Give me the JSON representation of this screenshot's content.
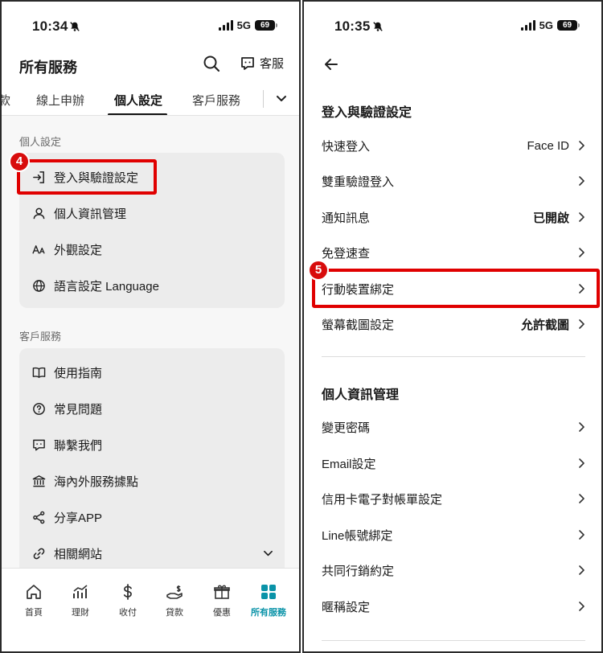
{
  "left": {
    "status": {
      "time": "10:34",
      "network": "5G",
      "battery": "69"
    },
    "header": {
      "title": "所有服務",
      "customer_service": "客服"
    },
    "tabs": [
      {
        "label": "款"
      },
      {
        "label": "線上申辦"
      },
      {
        "label": "個人設定",
        "active": true
      },
      {
        "label": "客戶服務"
      }
    ],
    "sections": [
      {
        "title": "個人設定",
        "items": [
          {
            "label": "登入與驗證設定",
            "icon": "login-icon"
          },
          {
            "label": "個人資訊管理",
            "icon": "person-icon"
          },
          {
            "label": "外觀設定",
            "icon": "font-size-icon"
          },
          {
            "label": "語言設定 Language",
            "icon": "globe-icon"
          }
        ]
      },
      {
        "title": "客戶服務",
        "items": [
          {
            "label": "使用指南",
            "icon": "book-icon"
          },
          {
            "label": "常見問題",
            "icon": "question-icon"
          },
          {
            "label": "聯繫我們",
            "icon": "contact-icon"
          },
          {
            "label": "海內外服務據點",
            "icon": "bank-icon"
          },
          {
            "label": "分享APP",
            "icon": "share-icon"
          },
          {
            "label": "相關網站",
            "icon": "link-icon"
          }
        ]
      }
    ],
    "step_badge": "4",
    "bottom_nav": [
      {
        "label": "首頁",
        "icon": "home-icon"
      },
      {
        "label": "理財",
        "icon": "chart-icon"
      },
      {
        "label": "收付",
        "icon": "dollar-icon"
      },
      {
        "label": "貸款",
        "icon": "loan-icon"
      },
      {
        "label": "優惠",
        "icon": "gift-icon"
      },
      {
        "label": "所有服務",
        "icon": "grid-icon",
        "active": true
      }
    ],
    "accent_color": "#0a93a8"
  },
  "right": {
    "status": {
      "time": "10:35",
      "network": "5G",
      "battery": "69"
    },
    "sections": [
      {
        "title": "登入與驗證設定",
        "items": [
          {
            "label": "快速登入",
            "value": "Face ID"
          },
          {
            "label": "雙重驗證登入",
            "value": ""
          },
          {
            "label": "通知訊息",
            "value": "已開啟"
          },
          {
            "label": "免登速查",
            "value": ""
          },
          {
            "label": "行動裝置綁定",
            "value": ""
          },
          {
            "label": "螢幕截圖設定",
            "value": "允許截圖"
          }
        ]
      },
      {
        "title": "個人資訊管理",
        "items": [
          {
            "label": "變更密碼"
          },
          {
            "label": "Email設定"
          },
          {
            "label": "信用卡電子對帳單設定"
          },
          {
            "label": "Line帳號綁定"
          },
          {
            "label": "共同行銷約定"
          },
          {
            "label": "暱稱設定"
          }
        ]
      }
    ],
    "step_badge": "5"
  },
  "highlight_color": "#e00000"
}
